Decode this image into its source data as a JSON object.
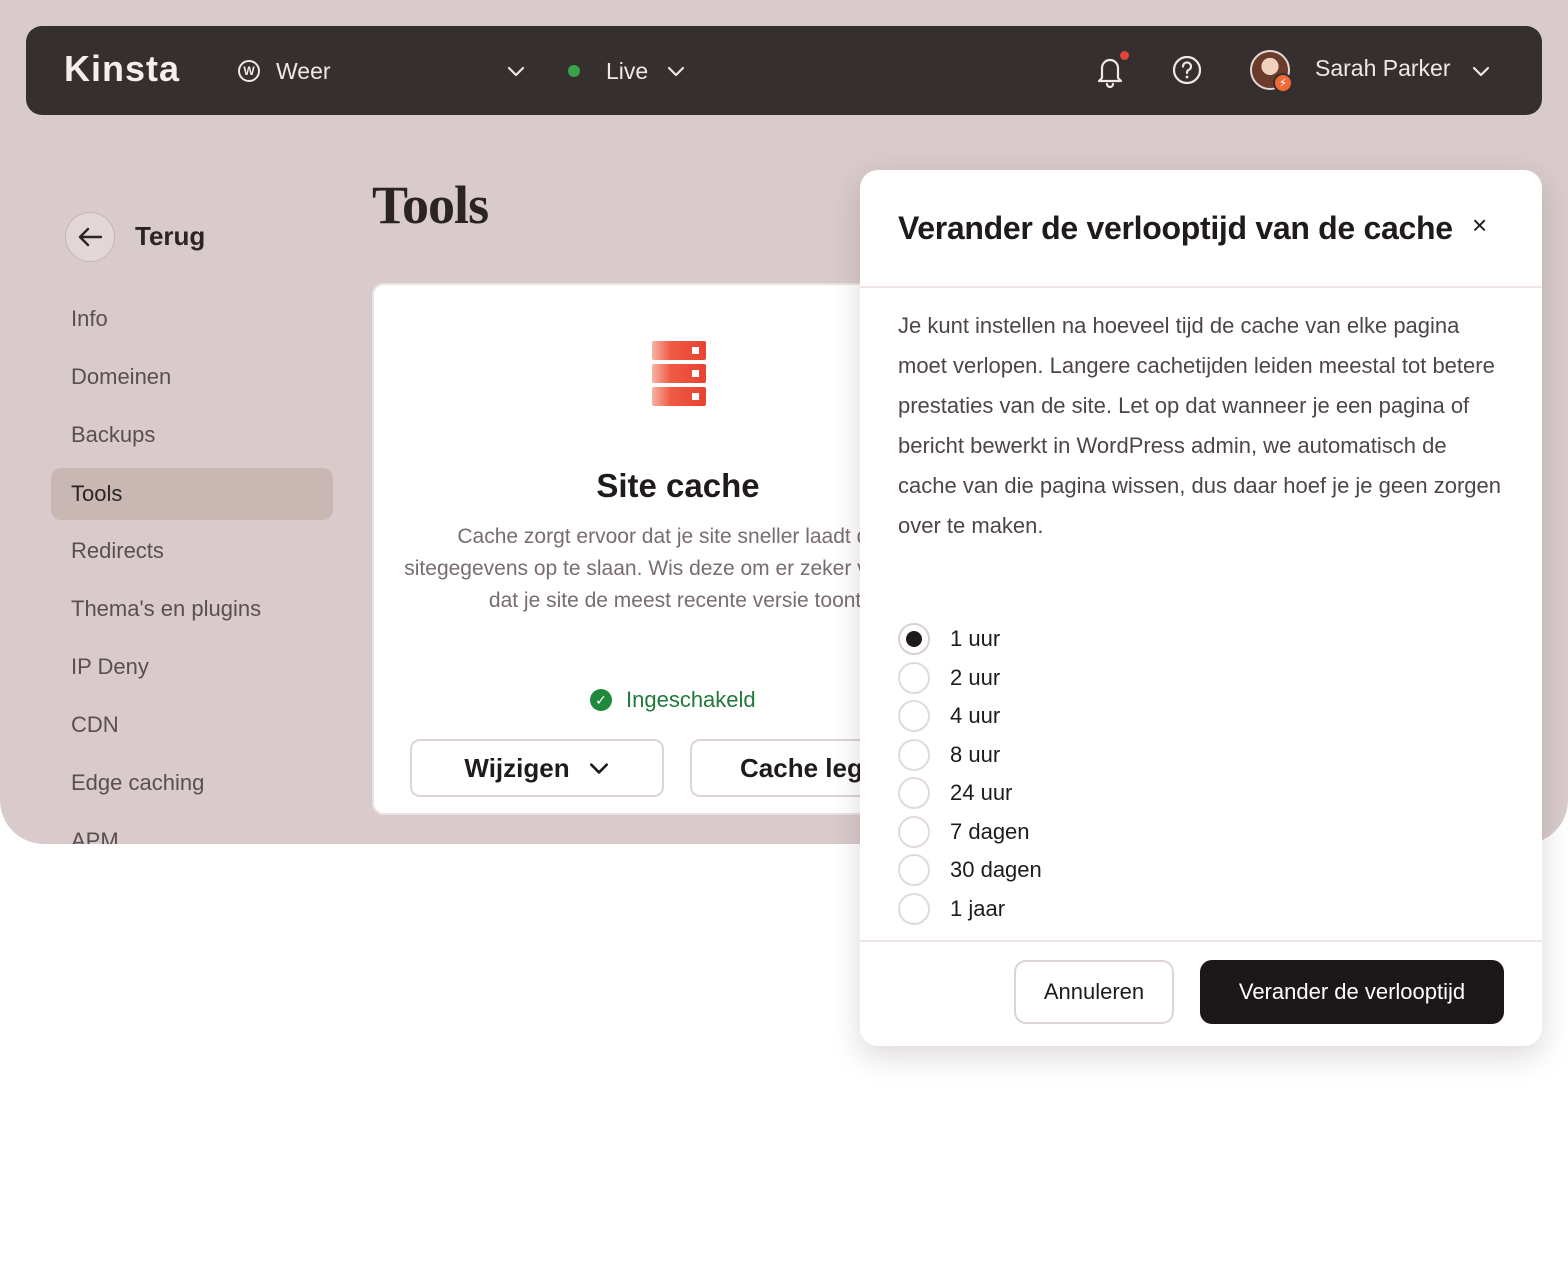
{
  "topbar": {
    "logo": "Kinsta",
    "site_name": "Weer",
    "environment": "Live",
    "user_name": "Sarah Parker"
  },
  "sidebar": {
    "back_label": "Terug",
    "items": [
      {
        "label": "Info"
      },
      {
        "label": "Domeinen"
      },
      {
        "label": "Backups"
      },
      {
        "label": "Tools",
        "active": true
      },
      {
        "label": "Redirects"
      },
      {
        "label": "Thema's en plugins"
      },
      {
        "label": "IP Deny"
      },
      {
        "label": "CDN"
      },
      {
        "label": "Edge caching"
      },
      {
        "label": "APM"
      }
    ]
  },
  "page": {
    "title": "Tools"
  },
  "card": {
    "title": "Site cache",
    "description": "Cache zorgt ervoor dat je site sneller laadt door sitegegevens op te slaan. Wis deze om er zeker van te zijn dat je site de meest recente versie toont.",
    "status": "Ingeschakeld",
    "change_label": "Wijzigen",
    "clear_label": "Cache legen"
  },
  "modal": {
    "title": "Verander de verlooptijd van de cache",
    "description": "Je kunt instellen na hoeveel tijd de cache van elke pagina moet verlopen. Langere cachetijden leiden meestal tot betere prestaties van de site. Let op dat wanneer je een pagina of bericht bewerkt in WordPress admin, we automatisch de cache van die pagina wissen, dus daar hoef je je geen zorgen over te maken.",
    "options": [
      "1 uur",
      "2 uur",
      "4 uur",
      "8 uur",
      "24 uur",
      "7 dagen",
      "30 dagen",
      "1 jaar"
    ],
    "selected": "1 uur",
    "cancel_label": "Annuleren",
    "confirm_label": "Verander de verlooptijd"
  },
  "colors": {
    "background": "#d9cbcb",
    "topbar": "#352f30",
    "status_green": "#1f7a3a",
    "brand_red": "#e8432f",
    "primary_button": "#1c1819"
  }
}
